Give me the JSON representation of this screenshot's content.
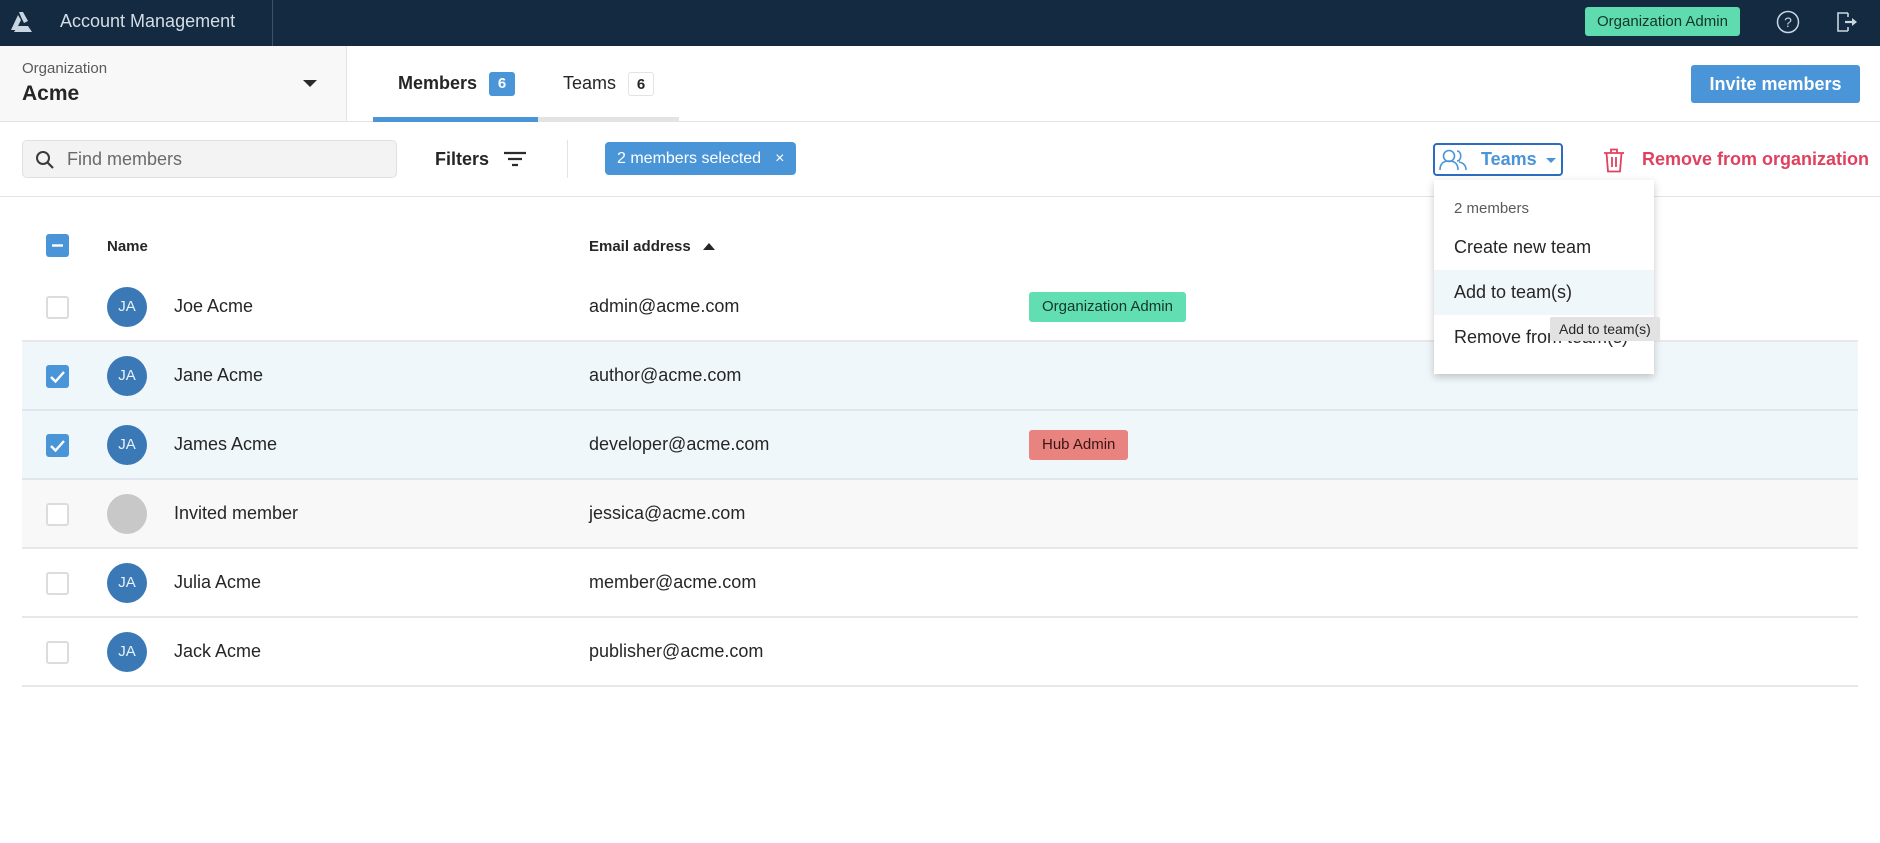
{
  "topbar": {
    "logo_icon": "triangle-logo-icon",
    "app_title": "Account Management",
    "role_badge": "Organization Admin",
    "help_icon": "help-circle-icon",
    "logout_icon": "logout-icon"
  },
  "org_selector": {
    "label": "Organization",
    "value": "Acme",
    "icon": "caret-down-icon"
  },
  "tabs": [
    {
      "label": "Members",
      "count": "6",
      "active": true
    },
    {
      "label": "Teams",
      "count": "6",
      "active": false
    }
  ],
  "invite_button": "Invite members",
  "toolbar": {
    "search_placeholder": "Find members",
    "search_value": "",
    "filters_label": "Filters",
    "selection_chip": "2 members selected",
    "selection_chip_close": "×",
    "teams_button": "Teams",
    "remove_button": "Remove from organization"
  },
  "table": {
    "columns": {
      "name": "Name",
      "email": "Email address",
      "email_sort": "ascending"
    },
    "header_checkbox": "indeterminate",
    "rows": [
      {
        "initials": "JA",
        "name": "Joe Acme",
        "email": "admin@acme.com",
        "role": "Organization Admin",
        "checked": false
      },
      {
        "initials": "JA",
        "name": "Jane Acme",
        "email": "author@acme.com",
        "role": "",
        "checked": true
      },
      {
        "initials": "JA",
        "name": "James Acme",
        "email": "developer@acme.com",
        "role": "Hub Admin",
        "checked": true
      },
      {
        "initials": "",
        "name": "Invited member",
        "email": "jessica@acme.com",
        "role": "",
        "checked": false
      },
      {
        "initials": "JA",
        "name": "Julia Acme",
        "email": "member@acme.com",
        "role": "",
        "checked": false
      },
      {
        "initials": "JA",
        "name": "Jack Acme",
        "email": "publisher@acme.com",
        "role": "",
        "checked": false
      }
    ]
  },
  "teams_menu": {
    "heading": "2 members",
    "items": [
      "Create new team",
      "Add to team(s)",
      "Remove from team(s)"
    ],
    "hovered": "Add to team(s)",
    "tooltip": "Add to team(s)"
  },
  "colors": {
    "topbar": "#132a40",
    "accent": "#4a95d8",
    "danger": "#e0415f",
    "org_admin_tag": "#62dfb2",
    "hub_admin_tag": "#e8837f",
    "selected_row": "#f0f7fb"
  }
}
